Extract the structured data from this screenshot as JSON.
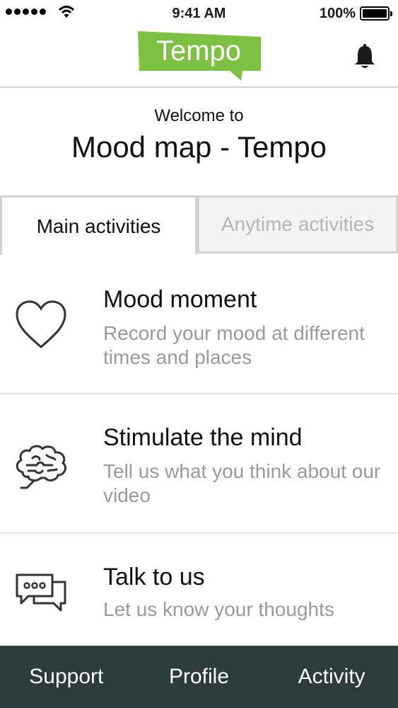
{
  "status_bar": {
    "time": "9:41 AM",
    "battery": "100%"
  },
  "header": {
    "logo_text": "Tempo",
    "brand_color": "#7dc142",
    "notification_icon": "bell-icon"
  },
  "welcome": {
    "line1": "Welcome to",
    "title": "Mood map - Tempo"
  },
  "tabs": [
    {
      "label": "Main activities",
      "active": true
    },
    {
      "label": "Anytime activities",
      "active": false
    }
  ],
  "activities": [
    {
      "icon": "heart-icon",
      "title": "Mood moment",
      "description": "Record your mood at different times and places"
    },
    {
      "icon": "brain-icon",
      "title": "Stimulate the mind",
      "description": "Tell us what you think about our video"
    },
    {
      "icon": "chat-bubbles-icon",
      "title": "Talk to us",
      "description": "Let us know your thoughts"
    }
  ],
  "bottom_nav": [
    {
      "label": "Support"
    },
    {
      "label": "Profile"
    },
    {
      "label": "Activity"
    }
  ],
  "colors": {
    "nav_background": "#2c3b3b",
    "secondary_text": "#9a9a9a"
  }
}
